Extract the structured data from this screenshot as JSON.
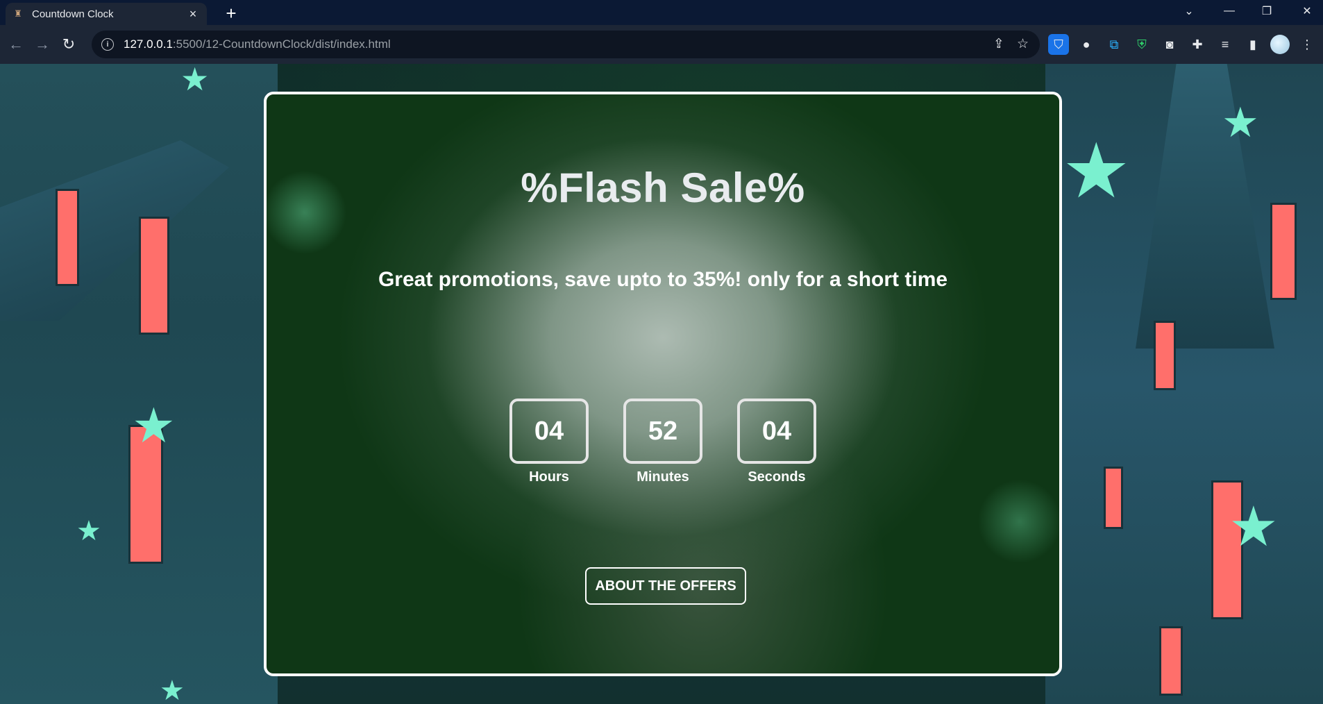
{
  "browser": {
    "tab_title": "Countdown Clock",
    "tab_close": "×",
    "new_tab": "+",
    "url_host": "127.0.0.1",
    "url_path": ":5500/12-CountdownClock/dist/index.html",
    "window_controls": {
      "dropdown": "⌄",
      "minimize": "—",
      "restore": "❐",
      "close": "✕"
    }
  },
  "page": {
    "title": "%Flash Sale%",
    "subtitle": "Great promotions, save upto to 35%! only for a short time",
    "timer": [
      {
        "value": "04",
        "label": "Hours"
      },
      {
        "value": "52",
        "label": "Minutes"
      },
      {
        "value": "04",
        "label": "Seconds"
      }
    ],
    "button_label": "ABOUT THE OFFERS"
  },
  "colors": {
    "card_bg": "#0f3716",
    "card_border": "#ffffff",
    "accent_star": "#7af0cf",
    "window_glow": "#ff6f6b"
  }
}
